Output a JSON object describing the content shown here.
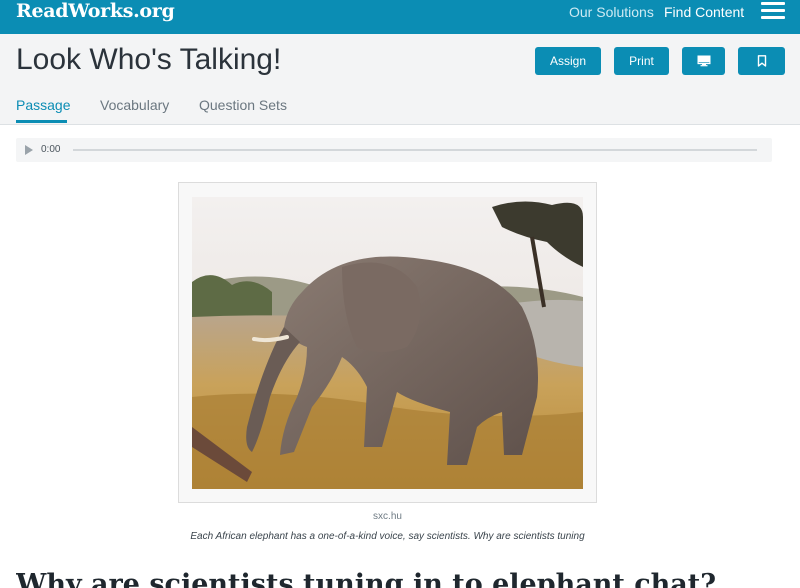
{
  "app": {
    "logo_text": "ReadWorks.org"
  },
  "nav": {
    "our_solutions": "Our Solutions",
    "find_content": "Find Content",
    "menu_icon": "hamburger-menu-icon"
  },
  "header": {
    "title": "Look Who's Talking!",
    "buttons": {
      "assign": "Assign",
      "print": "Print",
      "present_icon": "monitor-icon",
      "bookmark_icon": "bookmark-icon"
    }
  },
  "tabs": [
    {
      "label": "Passage",
      "active": true
    },
    {
      "label": "Vocabulary",
      "active": false
    },
    {
      "label": "Question Sets",
      "active": false
    }
  ],
  "audio": {
    "time": "0:00",
    "play_icon": "play-icon",
    "progress": 0
  },
  "figure": {
    "credit": "sxc.hu",
    "caption": "Each African elephant has a one-of-a-kind voice, say scientists. Why are scientists tuning"
  },
  "passage": {
    "heading": "Why are scientists tuning in to elephant chat?"
  },
  "colors": {
    "brand": "#0b8db4",
    "header_bg": "#f3f4f5",
    "title_text": "#2b333b",
    "inactive_tab": "#6b7780"
  }
}
